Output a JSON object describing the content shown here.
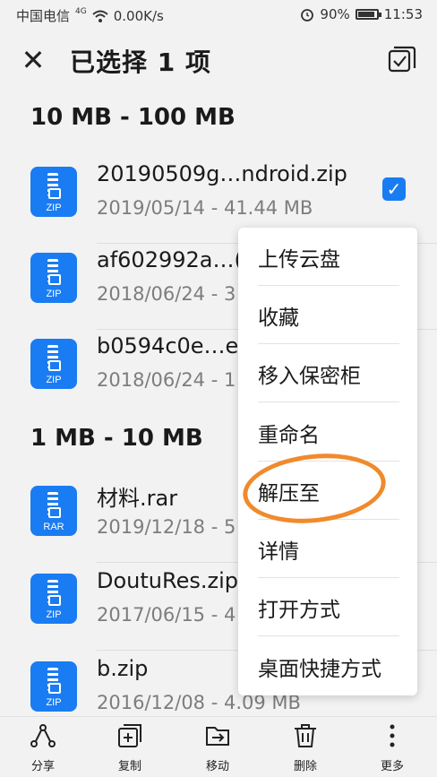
{
  "status_bar": {
    "carrier": "中国电信",
    "network": "4G",
    "speed": "0.00K/s",
    "battery": "90%",
    "time": "11:53"
  },
  "header": {
    "title": "已选择 1 项"
  },
  "sections": [
    {
      "label": "10 MB - 100 MB"
    },
    {
      "label": "1 MB - 10 MB"
    }
  ],
  "files": [
    {
      "name": "20190509g…ndroid.zip",
      "meta": "2019/05/14 - 41.44 MB",
      "ext": "ZIP",
      "selected": true
    },
    {
      "name": "af602992a…(",
      "meta": "2018/06/24 - 3",
      "ext": "ZIP",
      "selected": false
    },
    {
      "name": "b0594c0e…e",
      "meta": "2018/06/24 - 1",
      "ext": "ZIP",
      "selected": false
    },
    {
      "name": "材料.rar",
      "meta": "2019/12/18 - 5",
      "ext": "RAR",
      "selected": false
    },
    {
      "name": "DoutuRes.zip",
      "meta": "2017/06/15 - 4",
      "ext": "ZIP",
      "selected": false
    },
    {
      "name": "b.zip",
      "meta": "2016/12/08 - 4.09 MB",
      "ext": "ZIP",
      "selected": false
    }
  ],
  "context_menu": [
    {
      "label": "上传云盘"
    },
    {
      "label": "收藏"
    },
    {
      "label": "移入保密柜"
    },
    {
      "label": "重命名"
    },
    {
      "label": "解压至"
    },
    {
      "label": "详情"
    },
    {
      "label": "打开方式"
    },
    {
      "label": "桌面快捷方式"
    }
  ],
  "toolbar": [
    {
      "label": "分享",
      "icon": "share-icon"
    },
    {
      "label": "复制",
      "icon": "copy-icon"
    },
    {
      "label": "移动",
      "icon": "move-icon"
    },
    {
      "label": "删除",
      "icon": "delete-icon"
    },
    {
      "label": "更多",
      "icon": "more-icon"
    }
  ],
  "colors": {
    "accent": "#1a7cf2",
    "annotation": "#f08a2c"
  }
}
